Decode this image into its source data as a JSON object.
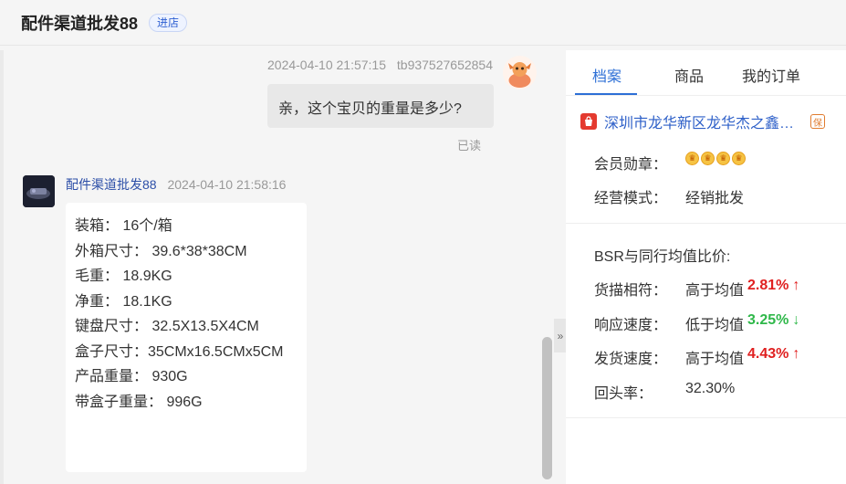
{
  "header": {
    "shop_name": "配件渠道批发88",
    "enter_label": "进店"
  },
  "chat": {
    "outgoing": {
      "time": "2024-04-10 21:57:15",
      "user": "tb937527652854",
      "text": "亲，这个宝贝的重量是多少?",
      "status": "已读"
    },
    "incoming": {
      "sender": "配件渠道批发88",
      "time": "2024-04-10 21:58:16",
      "lines": [
        "装箱： 16个/箱",
        "外箱尺寸： 39.6*38*38CM",
        "毛重： 18.9KG",
        "净重： 18.1KG",
        "键盘尺寸： 32.5X13.5X4CM",
        "盒子尺寸：35CMx16.5CMx5CM",
        "产品重量： 930G",
        "带盒子重量： 996G"
      ]
    },
    "collapse_glyph": "»"
  },
  "panel": {
    "tabs": [
      "档案",
      "商品",
      "我的订单"
    ],
    "active_tab": 0,
    "company_name": "深圳市龙华新区龙华杰之鑫贸易商行",
    "company_badge": "保",
    "medal_label": "会员勋章：",
    "medal_count": 4,
    "mode_label": "经营模式：",
    "mode_value": "经销批发",
    "bsr_title": "BSR与同行均值比价:",
    "metrics": [
      {
        "label": "货描相符：",
        "compare": "高于均值",
        "value": "2.81%",
        "arrow": "↑",
        "trend": "up",
        "color": "#e02020"
      },
      {
        "label": "响应速度：",
        "compare": "低于均值",
        "value": "3.25%",
        "arrow": "↓",
        "trend": "down",
        "color": "#2fb84a"
      },
      {
        "label": "发货速度：",
        "compare": "高于均值",
        "value": "4.43%",
        "arrow": "↑",
        "trend": "up",
        "color": "#e02020"
      }
    ],
    "return_label": "回头率：",
    "return_value": "32.30%"
  }
}
